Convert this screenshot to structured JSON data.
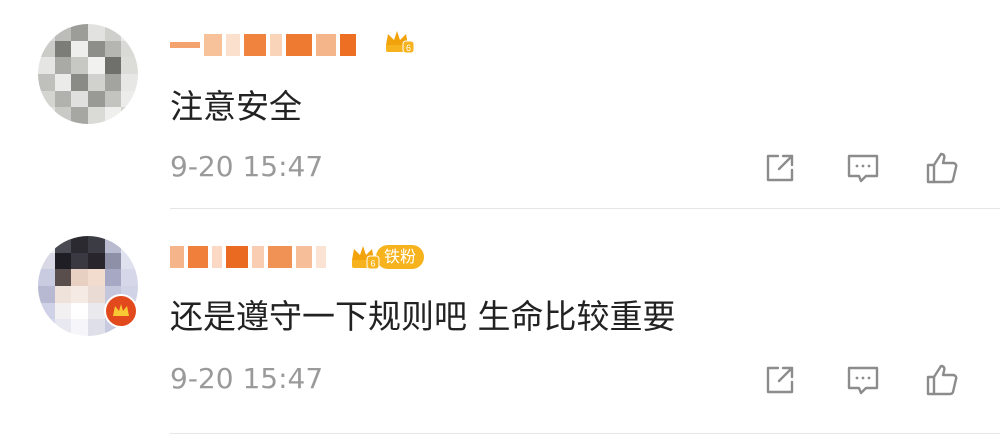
{
  "comments": [
    {
      "text": "注意安全",
      "time": "9-20 15:47",
      "badge": {
        "icon": "vip-crown-icon",
        "label": "",
        "level": "6"
      }
    },
    {
      "text": "还是遵守一下规则吧 生命比较重要",
      "time": "9-20 15:47",
      "badge": {
        "icon": "fan-crown-icon",
        "label": "铁粉",
        "level": "6"
      }
    }
  ],
  "actions": {
    "share_icon": "share-icon",
    "reply_icon": "reply-icon",
    "like_icon": "thumbs-up-icon"
  },
  "colors": {
    "text": "#222222",
    "meta": "#9a9a9a",
    "badge_gold": "#f7b31d",
    "username_orange": "#f06a2a",
    "divider": "#e6e6e6"
  }
}
